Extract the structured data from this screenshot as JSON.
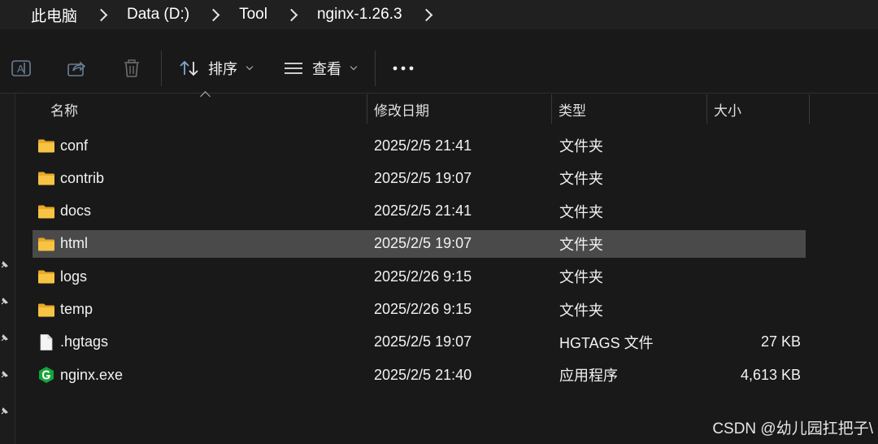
{
  "breadcrumb": {
    "items": [
      "此电脑",
      "Data (D:)",
      "Tool",
      "nginx-1.26.3"
    ]
  },
  "toolbar": {
    "sort_label": "排序",
    "view_label": "查看"
  },
  "columns": {
    "name": "名称",
    "date": "修改日期",
    "type": "类型",
    "size": "大小"
  },
  "files": [
    {
      "name": "conf",
      "date": "2025/2/5 21:41",
      "type": "文件夹",
      "size": "",
      "icon": "folder-icon"
    },
    {
      "name": "contrib",
      "date": "2025/2/5 19:07",
      "type": "文件夹",
      "size": "",
      "icon": "folder-icon"
    },
    {
      "name": "docs",
      "date": "2025/2/5 21:41",
      "type": "文件夹",
      "size": "",
      "icon": "folder-icon"
    },
    {
      "name": "html",
      "date": "2025/2/5 19:07",
      "type": "文件夹",
      "size": "",
      "icon": "folder-icon"
    },
    {
      "name": "logs",
      "date": "2025/2/26 9:15",
      "type": "文件夹",
      "size": "",
      "icon": "folder-icon"
    },
    {
      "name": "temp",
      "date": "2025/2/26 9:15",
      "type": "文件夹",
      "size": "",
      "icon": "folder-icon"
    },
    {
      "name": ".hgtags",
      "date": "2025/2/5 19:07",
      "type": "HGTAGS 文件",
      "size": "27 KB",
      "icon": "file-icon"
    },
    {
      "name": "nginx.exe",
      "date": "2025/2/5 21:40",
      "type": "应用程序",
      "size": "4,613 KB",
      "icon": "nginx-app-icon"
    }
  ],
  "selected_file": "html",
  "watermark": "CSDN @幼儿园扛把子\\",
  "colors": {
    "background": "#191919",
    "header_bar": "#202020",
    "selected_row": "#4a4a4a",
    "folder": "#f6c344",
    "nginx_green": "#13a538"
  }
}
